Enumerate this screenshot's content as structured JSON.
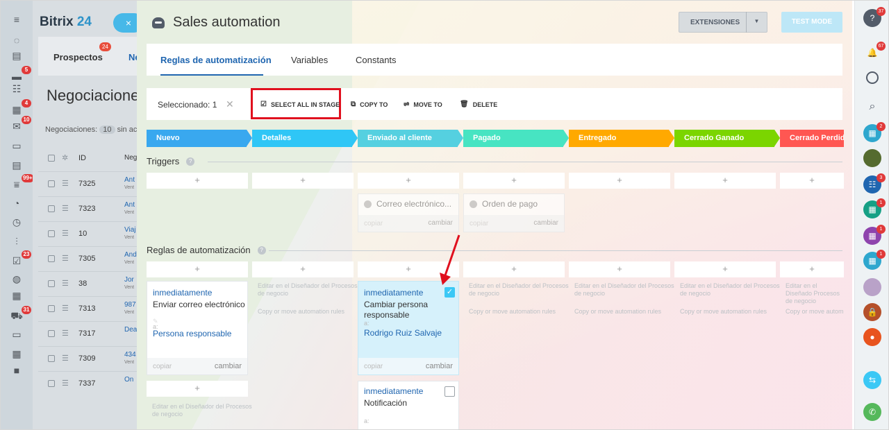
{
  "left_sidebar": {
    "items": [
      {
        "icon": "menu-icon",
        "glyph": "≡"
      },
      {
        "icon": "feed-icon",
        "glyph": "◌"
      },
      {
        "icon": "tasks-icon",
        "glyph": "▤"
      },
      {
        "icon": "chat-icon",
        "glyph": "▬",
        "badge": "5"
      },
      {
        "icon": "groups-icon",
        "glyph": "☷"
      },
      {
        "icon": "calendar-icon",
        "glyph": "▦",
        "badge": "4"
      },
      {
        "icon": "mail-icon",
        "glyph": "✉",
        "badge": "10"
      },
      {
        "icon": "drive-icon",
        "glyph": "▭"
      },
      {
        "icon": "docs-icon",
        "glyph": "▤"
      },
      {
        "icon": "crm-icon",
        "glyph": "⩸",
        "badge": "99+"
      },
      {
        "icon": "sites-icon",
        "glyph": "◔"
      },
      {
        "icon": "time-icon",
        "glyph": "◷"
      },
      {
        "icon": "reports-icon",
        "glyph": "⫶"
      },
      {
        "icon": "approvals-icon",
        "glyph": "☑",
        "badge": "23"
      },
      {
        "icon": "robot-icon",
        "glyph": "◍"
      },
      {
        "icon": "printer-icon",
        "glyph": "▦"
      },
      {
        "icon": "cart-icon",
        "glyph": "⛟",
        "badge": "31"
      },
      {
        "icon": "screen-icon",
        "glyph": "▭"
      },
      {
        "icon": "apps-icon",
        "glyph": "▦"
      },
      {
        "icon": "video-icon",
        "glyph": "■"
      }
    ]
  },
  "crm": {
    "logo_a": "Bitrix",
    "logo_b": " 24",
    "close_label": "×",
    "tab_prospects": "Prospectos",
    "tab_prospects_badge": "24",
    "tab_deals": "Ne",
    "title": "Negociaciones",
    "count_label": "Negociaciones:",
    "count_value": "10",
    "count_suffix": "sin ac",
    "header_id": "ID",
    "header_name": "Neg",
    "rows": [
      {
        "id": "7325",
        "name": "Ant",
        "sub": "Vent"
      },
      {
        "id": "7323",
        "name": "Ant",
        "sub": "Vent"
      },
      {
        "id": "10",
        "name": "Viaj",
        "sub": "Vent"
      },
      {
        "id": "7305",
        "name": "And",
        "sub": "Vent"
      },
      {
        "id": "38",
        "name": "Jor",
        "sub": "Vent"
      },
      {
        "id": "7313",
        "name": "987",
        "sub": "Vent"
      },
      {
        "id": "7317",
        "name": "Dea",
        "sub": ""
      },
      {
        "id": "7309",
        "name": "434",
        "sub": "Vent"
      },
      {
        "id": "7337",
        "name": "On",
        "sub": ""
      }
    ]
  },
  "panel": {
    "title": "Sales automation",
    "extensions": "EXTENSIONES",
    "test_mode": "TEST MODE",
    "tabs": [
      "Reglas de automatización",
      "Variables",
      "Constants"
    ],
    "selected": "Seleccionado: 1",
    "select_all": "SELECT ALL IN STAGE",
    "copy_to": "COPY TO",
    "move_to": "MOVE TO",
    "delete": "DELETE",
    "stages": [
      {
        "label": "Nuevo",
        "color": "#39a8ef"
      },
      {
        "label": "Detalles",
        "color": "#2fc6f6"
      },
      {
        "label": "Enviado al cliente",
        "color": "#55d0e0"
      },
      {
        "label": "Pagado",
        "color": "#47e4c2"
      },
      {
        "label": "Entregado",
        "color": "#ffa900"
      },
      {
        "label": "Cerrado Ganado",
        "color": "#7bd500"
      },
      {
        "label": "Cerrado Perdido",
        "color": "#ff5752"
      }
    ],
    "triggers_label": "Triggers",
    "rules_label": "Reglas de automatización",
    "plus": "+",
    "trigger_cards": [
      {
        "name": "Correo electrónico...",
        "copy": "copiar",
        "change": "cambiar"
      },
      {
        "name": "Orden de pago",
        "copy": "copiar",
        "change": "cambiar"
      }
    ],
    "rule_card_1": {
      "when": "inmediatamente",
      "text": "Enviar correo electrónico",
      "a": "a:",
      "who": "Persona responsable",
      "copy": "copiar",
      "change": "cambiar"
    },
    "rule_card_2": {
      "when": "inmediatamente",
      "text": "Cambiar persona responsable",
      "a": "a:",
      "who": "Rodrigo Ruiz Salvaje",
      "copy": "copiar",
      "change": "cambiar"
    },
    "rule_card_3": {
      "when": "inmediatamente",
      "text": "Notificación",
      "a": "a:"
    },
    "faint_edit": "Editar en el Diseñador del Procesos de negocio",
    "faint_copy": "Copy or move automation rules",
    "faint_edit_cut": "Editar en el Diseñado Procesos de negocio",
    "faint_copy_cut": "Copy or move autom"
  },
  "right_sidebar": {
    "help_badge": "37",
    "bell_badge": "67",
    "items_badges": [
      "2",
      "3",
      "1",
      "1",
      "1"
    ]
  }
}
